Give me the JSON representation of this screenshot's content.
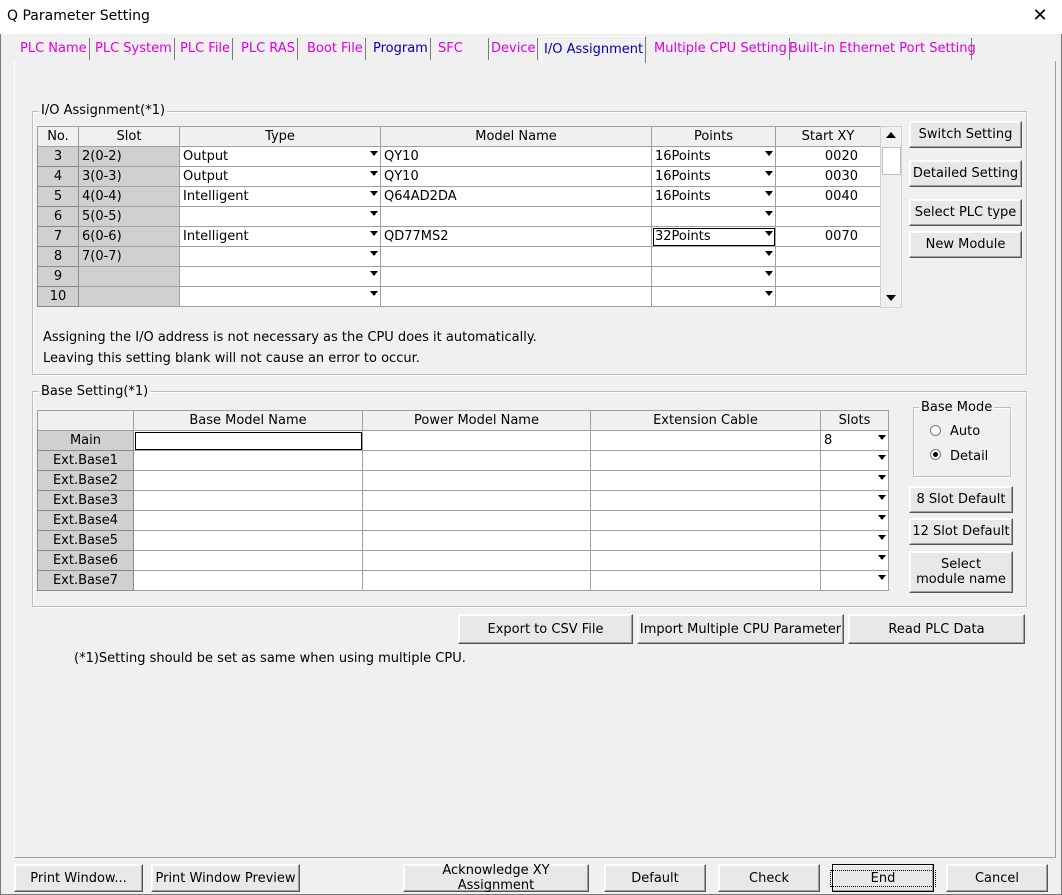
{
  "window": {
    "title": "Q Parameter Setting",
    "close_symbol": "✕"
  },
  "tabs": [
    {
      "label": "PLC Name"
    },
    {
      "label": "PLC System"
    },
    {
      "label": "PLC File"
    },
    {
      "label": "PLC RAS"
    },
    {
      "label": "Boot File"
    },
    {
      "label": "Program"
    },
    {
      "label": "SFC"
    },
    {
      "label": "Device"
    },
    {
      "label": "I/O Assignment"
    },
    {
      "label": "Multiple CPU Setting"
    },
    {
      "label": "Built-in Ethernet Port Setting"
    }
  ],
  "io": {
    "group_label": "I/O Assignment(*1)",
    "headers": {
      "no": "No.",
      "slot": "Slot",
      "type": "Type",
      "model": "Model Name",
      "points": "Points",
      "start": "Start XY"
    },
    "rows": [
      {
        "no": "3",
        "slot": "2(0-2)",
        "type": "Output",
        "model": "QY10",
        "points": "16Points",
        "start": "0020"
      },
      {
        "no": "4",
        "slot": "3(0-3)",
        "type": "Output",
        "model": "QY10",
        "points": "16Points",
        "start": "0030"
      },
      {
        "no": "5",
        "slot": "4(0-4)",
        "type": "Intelligent",
        "model": "Q64AD2DA",
        "points": "16Points",
        "start": "0040"
      },
      {
        "no": "6",
        "slot": "5(0-5)",
        "type": "",
        "model": "",
        "points": "",
        "start": ""
      },
      {
        "no": "7",
        "slot": "6(0-6)",
        "type": "Intelligent",
        "model": "QD77MS2",
        "points": "32Points",
        "start": "0070"
      },
      {
        "no": "8",
        "slot": "7(0-7)",
        "type": "",
        "model": "",
        "points": "",
        "start": ""
      },
      {
        "no": "9",
        "slot": "",
        "type": "",
        "model": "",
        "points": "",
        "start": ""
      },
      {
        "no": "10",
        "slot": "",
        "type": "",
        "model": "",
        "points": "",
        "start": ""
      }
    ],
    "buttons": {
      "switch": "Switch Setting",
      "detailed": "Detailed Setting",
      "select_plc": "Select PLC type",
      "new_module": "New Module"
    },
    "note1": "Assigning the I/O address is not necessary as the CPU does it automatically.",
    "note2": "Leaving this setting blank will not cause an error to occur."
  },
  "base": {
    "group_label": "Base Setting(*1)",
    "headers": {
      "base_model": "Base Model Name",
      "power_model": "Power Model Name",
      "ext_cable": "Extension Cable",
      "slots": "Slots"
    },
    "rows": [
      {
        "name": "Main",
        "slots": "8"
      },
      {
        "name": "Ext.Base1",
        "slots": ""
      },
      {
        "name": "Ext.Base2",
        "slots": ""
      },
      {
        "name": "Ext.Base3",
        "slots": ""
      },
      {
        "name": "Ext.Base4",
        "slots": ""
      },
      {
        "name": "Ext.Base5",
        "slots": ""
      },
      {
        "name": "Ext.Base6",
        "slots": ""
      },
      {
        "name": "Ext.Base7",
        "slots": ""
      }
    ],
    "mode_label": "Base Mode",
    "mode_auto": "Auto",
    "mode_detail": "Detail",
    "mode_selected": "Detail",
    "btn_8slot": "8 Slot Default",
    "btn_12slot": "12 Slot Default",
    "btn_select_module_1": "Select",
    "btn_select_module_2": "module name"
  },
  "actions": {
    "export_csv": "Export to CSV File",
    "import_multi": "Import Multiple CPU Parameter",
    "read_plc": "Read PLC Data"
  },
  "footnote": "(*1)Setting should be set as same when using multiple CPU.",
  "bottom": {
    "print_window": "Print Window...",
    "print_preview": "Print Window Preview",
    "ack_xy": "Acknowledge XY Assignment",
    "default": "Default",
    "check": "Check",
    "end": "End",
    "cancel": "Cancel"
  },
  "colors": {
    "tab_text": "#e000e0",
    "tab_active_text": "#0000b0",
    "slot_cell": "#d0d0d0"
  }
}
